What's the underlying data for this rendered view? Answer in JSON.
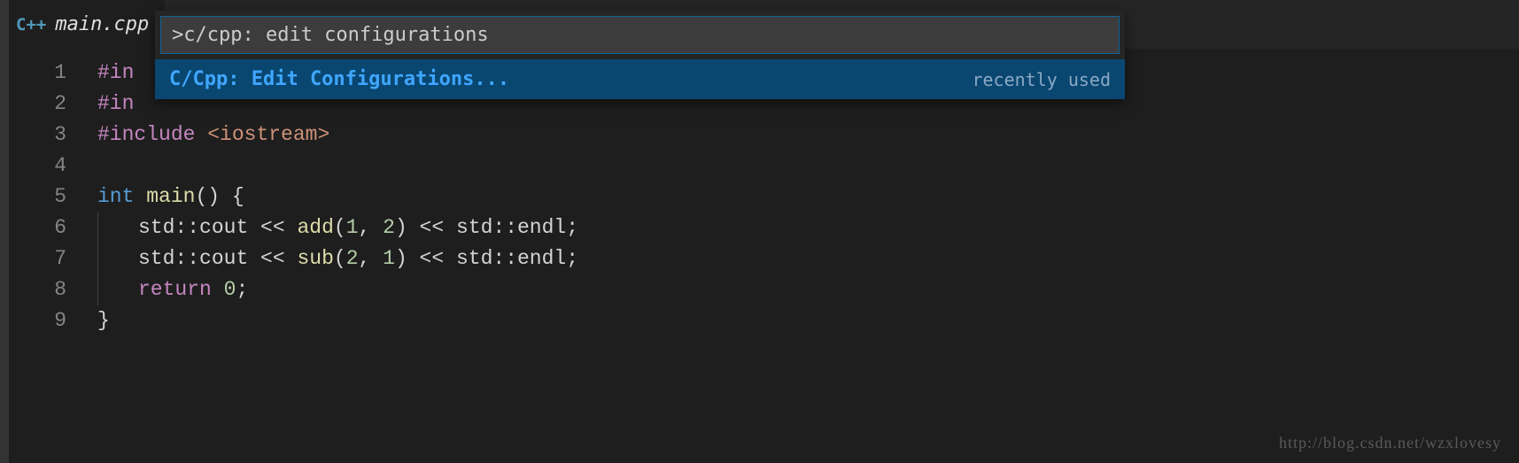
{
  "tab": {
    "icon": "C++",
    "label": "main.cpp"
  },
  "palette": {
    "input_value": ">c/cpp: edit configurations",
    "item_label": "C/Cpp: Edit Configurations...",
    "item_hint": "recently used"
  },
  "code": {
    "lines": [
      {
        "n": "1",
        "preproc": "#in",
        "rest": ""
      },
      {
        "n": "2",
        "preproc": "#in",
        "rest": ""
      },
      {
        "n": "3",
        "preproc": "#include",
        "path": "<iostream>"
      },
      {
        "n": "4"
      },
      {
        "n": "5",
        "type": "int",
        "func": "main",
        "sig": "() {"
      },
      {
        "n": "6",
        "body": "std::cout << add(1, 2) << std::endl;",
        "obj1": "std",
        "sep1": "::",
        "id1": "cout",
        "op1": " << ",
        "fn": "add",
        "lp": "(",
        "a1": "1",
        "cm": ", ",
        "a2": "2",
        "rp": ")",
        "op2": " << ",
        "obj2": "std",
        "sep2": "::",
        "id2": "endl",
        "sc": ";"
      },
      {
        "n": "7",
        "obj1": "std",
        "sep1": "::",
        "id1": "cout",
        "op1": " << ",
        "fn": "sub",
        "lp": "(",
        "a1": "2",
        "cm": ", ",
        "a2": "1",
        "rp": ")",
        "op2": " << ",
        "obj2": "std",
        "sep2": "::",
        "id2": "endl",
        "sc": ";"
      },
      {
        "n": "8",
        "ret": "return",
        "sp": " ",
        "val": "0",
        "sc2": ";"
      },
      {
        "n": "9",
        "brace": "}"
      }
    ]
  },
  "watermark": "http://blog.csdn.net/wzxlovesy"
}
